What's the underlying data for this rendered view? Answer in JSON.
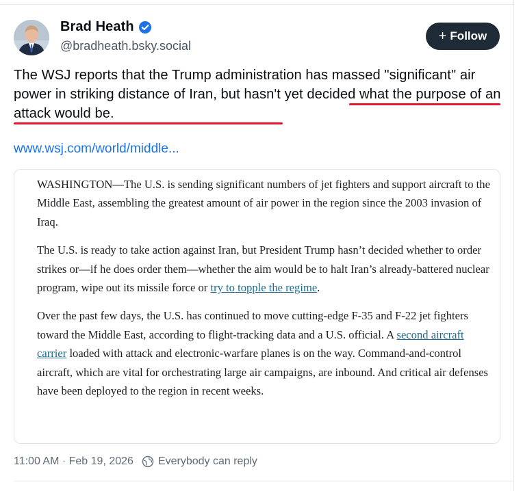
{
  "author": {
    "display_name": "Brad Heath",
    "handle": "@bradheath.bsky.social"
  },
  "follow_button": {
    "icon": "+",
    "label": "Follow"
  },
  "post": {
    "text_plain": "The WSJ reports that the Trump administration has massed \"significant\" air power in striking distance of Iran, ",
    "text_highlighted": "but hasn't yet decided what the purpose of an attack would be.",
    "link_text": "www.wsj.com/world/middle...",
    "highlight_color": "#e4172c"
  },
  "quote_article": {
    "para1": "WASHINGTON—The U.S. is sending significant numbers of jet fighters and support aircraft to the Middle East, assembling the greatest amount of air power in the region since the 2003 invasion of Iraq.",
    "para2_before": "The U.S. is ready to take action against Iran, but President Trump hasn’t decided whether to order strikes or—if he does order them—whether the aim would be to halt Iran’s already-battered nuclear program, wipe out its missile force or ",
    "para2_link": "try to topple the regime",
    "para2_after": ".",
    "para3_before": "Over the past few days, the U.S. has continued to move cutting-edge F-35 and F-22 jet fighters toward the Middle East, according to flight-tracking data and a U.S. official. A ",
    "para3_link": "second aircraft carrier",
    "para3_after": " loaded with attack and electronic-warfare planes is on the way. Command-and-control aircraft, which are vital for orchestrating large air campaigns, are inbound. And critical air defenses have been deployed to the region in recent weeks."
  },
  "meta": {
    "timestamp": "11:00 AM · Feb 19, 2026",
    "reply_setting": "Everybody can reply"
  },
  "colors": {
    "accent_link": "#1a73e8",
    "verified_badge": "#1d72e8",
    "follow_bg": "#1e2a36"
  }
}
